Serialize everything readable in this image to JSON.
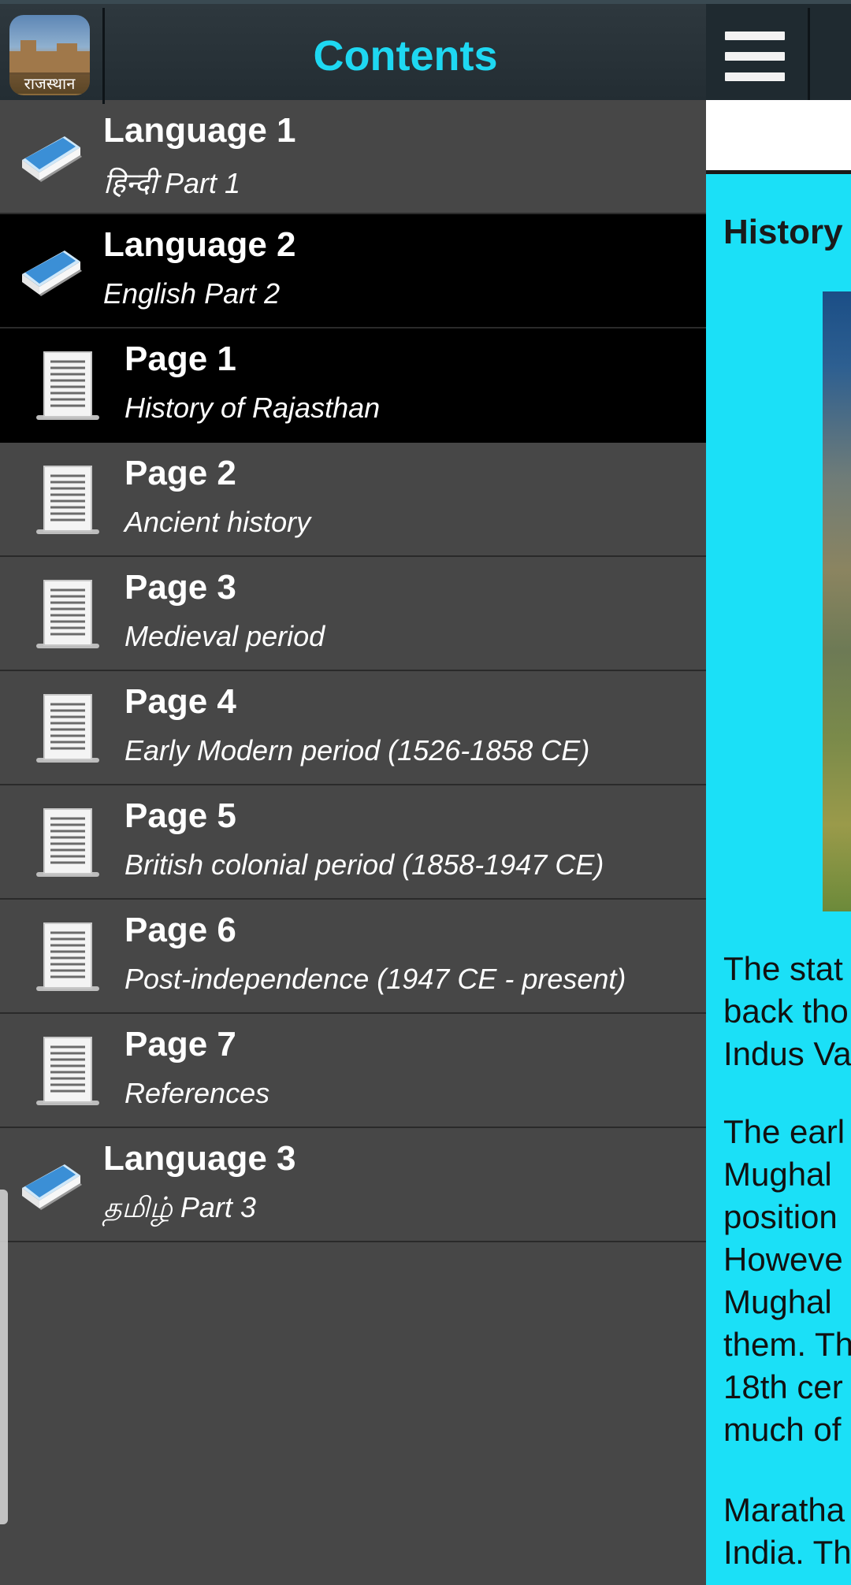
{
  "content": {
    "title": "History",
    "paragraphs": [
      [
        "The stat",
        "back tho",
        "Indus Va"
      ],
      [
        "The earl",
        "Mughal",
        "position",
        "Howeve",
        "Mughal",
        "them. Th",
        "18th cer",
        "much of"
      ],
      [
        "Maratha",
        "India. Th",
        "..."
      ]
    ]
  },
  "drawer": {
    "title": "Contents",
    "logo_text": "राजस्थान",
    "items": [
      {
        "type": "language",
        "title": "Language 1",
        "subtitle": "हिन्दी Part 1",
        "selected": false
      },
      {
        "type": "language",
        "title": "Language 2",
        "subtitle": "English Part 2",
        "selected": true
      },
      {
        "type": "page",
        "title": "Page 1",
        "subtitle": "History of Rajasthan",
        "selected": true
      },
      {
        "type": "page",
        "title": "Page 2",
        "subtitle": "Ancient history",
        "selected": false
      },
      {
        "type": "page",
        "title": "Page 3",
        "subtitle": "Medieval period",
        "selected": false
      },
      {
        "type": "page",
        "title": "Page 4",
        "subtitle": "Early Modern period (1526-1858 CE)",
        "selected": false
      },
      {
        "type": "page",
        "title": "Page 5",
        "subtitle": "British colonial period (1858-1947 CE)",
        "selected": false
      },
      {
        "type": "page",
        "title": "Page 6",
        "subtitle": "Post-independence (1947 CE - present)",
        "selected": false
      },
      {
        "type": "page",
        "title": "Page 7",
        "subtitle": "References",
        "selected": false
      },
      {
        "type": "language",
        "title": "Language 3",
        "subtitle": "தமிழ் Part 3",
        "selected": false
      }
    ]
  },
  "colors": {
    "accent": "#1ed8f2",
    "content_bg": "#1be0f7",
    "drawer_bg": "#474747",
    "selected_bg": "#000000"
  }
}
